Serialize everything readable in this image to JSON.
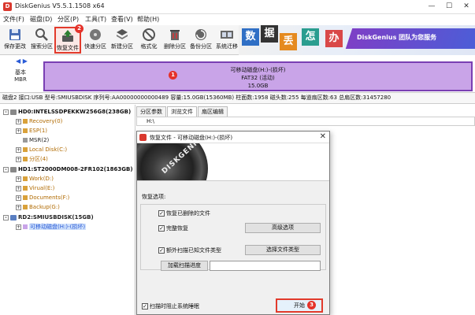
{
  "window": {
    "title": "DiskGenius V5.5.1.1508 x64",
    "controls": [
      "—",
      "☐",
      "✕"
    ]
  },
  "menu": [
    "文件(F)",
    "磁盘(D)",
    "分区(P)",
    "工具(T)",
    "查看(V)",
    "帮助(H)"
  ],
  "toolbar": [
    {
      "label": "保存更改",
      "icon": "save-icon"
    },
    {
      "label": "搜索分区",
      "icon": "magnifier-icon"
    },
    {
      "label": "恢复文件",
      "icon": "restore-icon"
    },
    {
      "label": "快速分区",
      "icon": "disk-icon"
    },
    {
      "label": "新建分区",
      "icon": "layers-icon"
    },
    {
      "label": "格式化",
      "icon": "format-icon"
    },
    {
      "label": "删除分区",
      "icon": "trash-icon"
    },
    {
      "label": "备份分区",
      "icon": "backup-icon"
    },
    {
      "label": "系统迁移",
      "icon": "migrate-icon"
    }
  ],
  "banner": {
    "tiles": [
      "数",
      "据",
      "丢",
      "怎",
      "办"
    ],
    "tagline": "DiskGenius 团队为您服务"
  },
  "disk_map": {
    "nav": "◀ ▶",
    "disk_label": [
      "基本",
      "MBR"
    ],
    "partition": [
      "可移动磁盘(H:)-(损坏)",
      "FAT32 (活动)",
      "15.0GB"
    ]
  },
  "info_bar": "磁盘2 接口:USB  型号:SMIUSBDISK  序列号:AA00000000000489  容量:15.0GB(15360MB)  柱面数:1958  磁头数:255  每道扇区数:63  总扇区数:31457280",
  "tree": [
    {
      "label": "HD0:INTELSSDPEKKW256G8(238GB)",
      "level": 0,
      "kind": "disk",
      "exp": "-"
    },
    {
      "label": "Recovery(0)",
      "level": 1,
      "kind": "part",
      "exp": "+"
    },
    {
      "label": "ESP(1)",
      "level": 1,
      "kind": "part",
      "exp": "+"
    },
    {
      "label": "MSR(2)",
      "level": 1,
      "kind": "part-normal",
      "exp": ""
    },
    {
      "label": "Local Disk(C:)",
      "level": 1,
      "kind": "part",
      "exp": "+"
    },
    {
      "label": "分区(4)",
      "level": 1,
      "kind": "part",
      "exp": "+"
    },
    {
      "label": "HD1:ST2000DM008-2FR102(1863GB)",
      "level": 0,
      "kind": "disk",
      "exp": "-"
    },
    {
      "label": "Work(D:)",
      "level": 1,
      "kind": "part",
      "exp": "+"
    },
    {
      "label": "Virual(E:)",
      "level": 1,
      "kind": "part",
      "exp": "+"
    },
    {
      "label": "Documents(F:)",
      "level": 1,
      "kind": "part",
      "exp": "+"
    },
    {
      "label": "Backup(G:)",
      "level": 1,
      "kind": "part",
      "exp": "+"
    },
    {
      "label": "RD2:SMIUSBDISK(15GB)",
      "level": 0,
      "kind": "disk-usb",
      "exp": "-"
    },
    {
      "label": "可移动磁盘(H:)-(损坏)",
      "level": 1,
      "kind": "selected",
      "exp": "+"
    }
  ],
  "tabs": [
    "分区参数",
    "浏览文件",
    "扇区编辑"
  ],
  "path": "H:\\",
  "dialog": {
    "title": "恢复文件 - 可移动磁盘(H:)-(损坏)",
    "close": "✕",
    "brand": "DISKGENIUS",
    "section_label": "恢复选项:",
    "opt_deleted": "恢复已删除的文件",
    "opt_full": "完整恢复",
    "advanced_button": "高级选项",
    "opt_extra": "额外扫描已知文件类型",
    "select_types_button": "选择文件类型",
    "load_progress_button": "加载扫描进度",
    "progress_path": "",
    "opt_sleep": "扫描时阻止系统睡眠",
    "start_button": "开始",
    "checked": "✓"
  },
  "markers": [
    "1",
    "2",
    "3"
  ],
  "colors": {
    "accent_red": "#e23a2b",
    "partition_fill": "#c9a4e8",
    "partition_border": "#7a3fb3",
    "part_text": "#b06a00"
  }
}
